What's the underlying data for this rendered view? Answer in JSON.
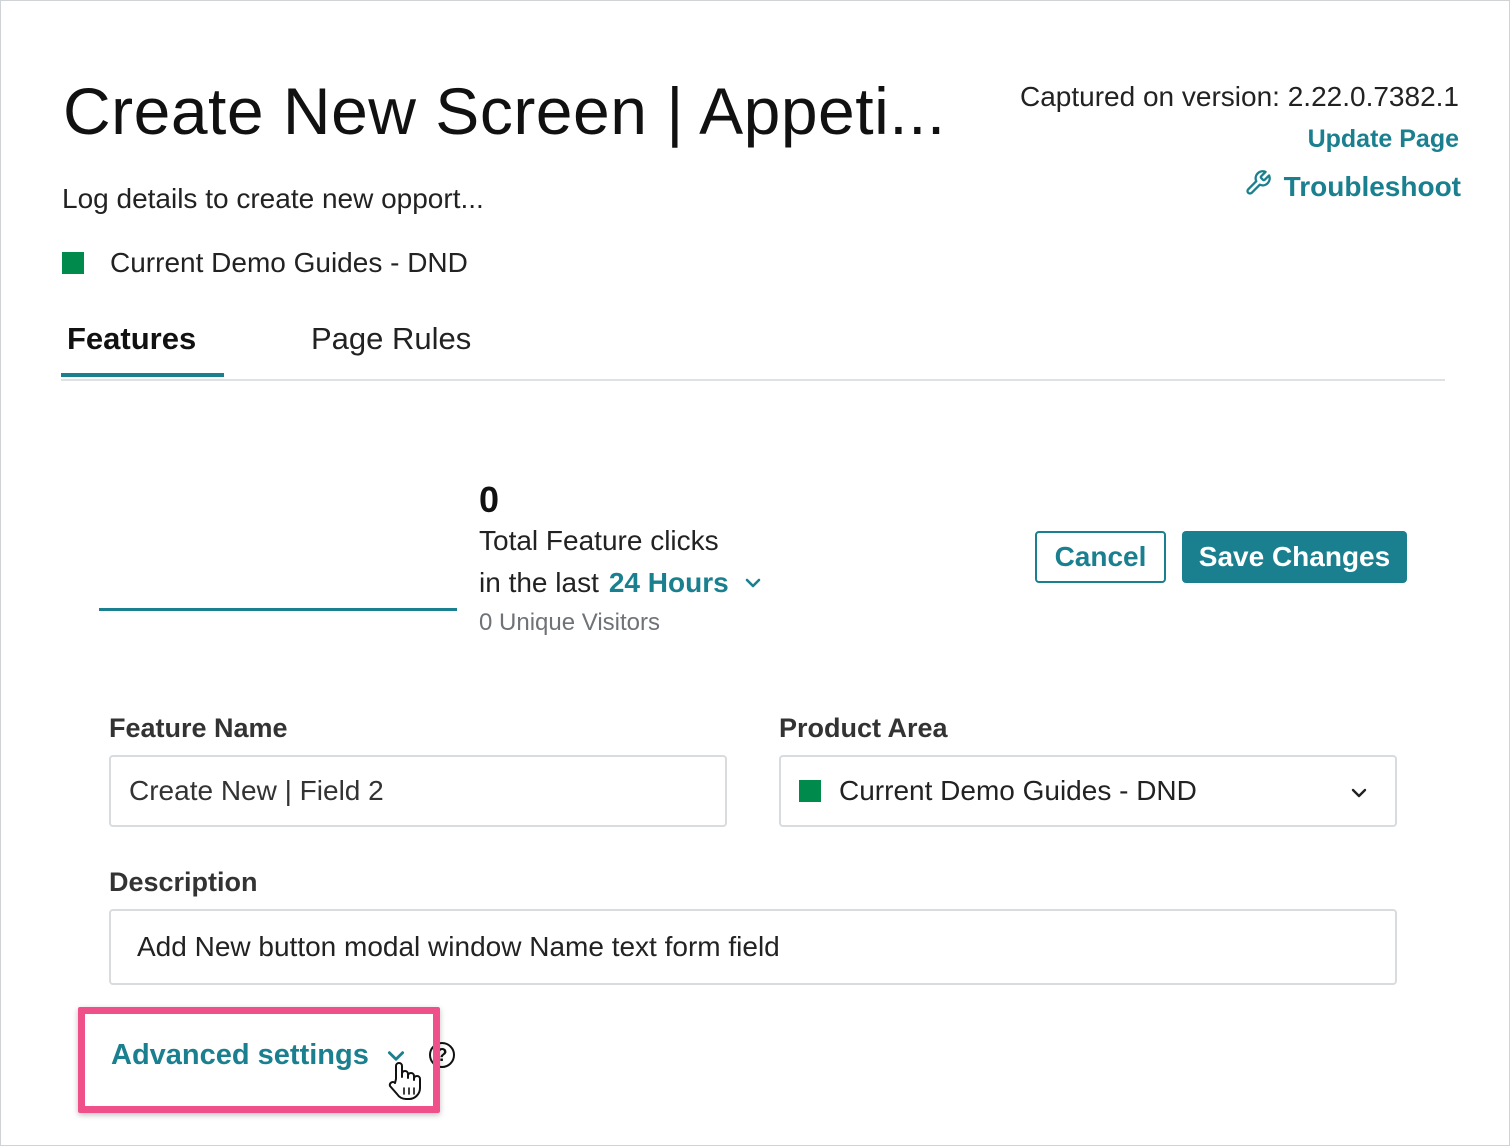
{
  "header": {
    "title": "Create New Screen | Appeti...",
    "subtitle": "Log details to create new opport...",
    "product_area": "Current Demo Guides - DND",
    "product_area_color": "#008a4c",
    "version_text": "Captured on version: 2.22.0.7382.1",
    "update_page": "Update Page",
    "troubleshoot": "Troubleshoot"
  },
  "tabs": [
    {
      "label": "Features",
      "active": true
    },
    {
      "label": "Page Rules",
      "active": false
    }
  ],
  "stats": {
    "clicks_count": "0",
    "clicks_label": "Total Feature clicks",
    "range_prefix": "in the last",
    "range_value": "24 Hours",
    "unique_visitors": "0 Unique Visitors"
  },
  "actions": {
    "cancel": "Cancel",
    "save": "Save Changes"
  },
  "form": {
    "feature_name_label": "Feature Name",
    "feature_name_value": "Create New | Field 2",
    "product_area_label": "Product Area",
    "product_area_value": "Current Demo Guides - DND",
    "description_label": "Description",
    "description_value": "Add New button modal window Name text form field"
  },
  "advanced": {
    "label": "Advanced settings",
    "help_glyph": "?"
  },
  "icons": {
    "troubleshoot": "wrench-icon",
    "range_toggle": "chevron-down-icon",
    "select_toggle": "chevron-down-icon",
    "advanced_toggle": "chevron-down-icon",
    "help": "help-icon",
    "cursor": "hand-pointer-icon"
  },
  "colors": {
    "accent": "#1a7f8e",
    "highlight": "#f0508a"
  }
}
